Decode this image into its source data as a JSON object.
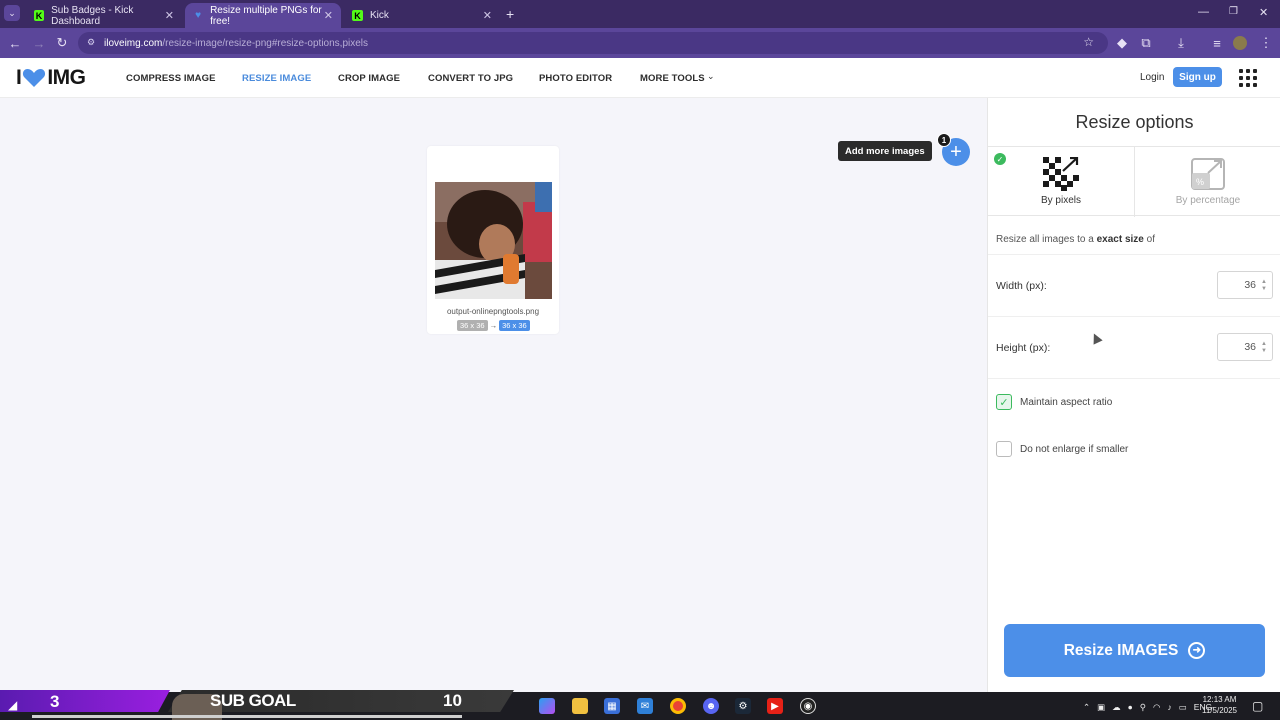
{
  "browser": {
    "tabs": [
      {
        "title": "Sub Badges - Kick Dashboard",
        "favicon": "kick-icon",
        "active": false
      },
      {
        "title": "Resize multiple PNGs for free!",
        "favicon": "iloveimg-heart-icon",
        "active": true
      },
      {
        "title": "Kick",
        "favicon": "kick-icon",
        "active": false
      }
    ],
    "new_tab": "+",
    "url_host": "iloveimg.com",
    "url_path": "/resize-image/resize-png#resize-options,pixels"
  },
  "site": {
    "logo_left": "I",
    "logo_right": "IMG",
    "nav": [
      {
        "label": "COMPRESS IMAGE",
        "active": false
      },
      {
        "label": "RESIZE IMAGE",
        "active": true
      },
      {
        "label": "CROP IMAGE",
        "active": false
      },
      {
        "label": "CONVERT TO JPG",
        "active": false
      },
      {
        "label": "PHOTO EDITOR",
        "active": false
      },
      {
        "label": "MORE TOOLS",
        "active": false
      }
    ],
    "login": "Login",
    "signup": "Sign up"
  },
  "workspace": {
    "file_name": "output-onlinepngtools.png",
    "original_size": "36 x 36",
    "arrow": "→",
    "new_size": "36 x 36",
    "add_more_label": "Add more images",
    "image_count": "1"
  },
  "sidebar": {
    "title": "Resize options",
    "mode_pixels": "By pixels",
    "mode_percentage": "By percentage",
    "desc_prefix": "Resize all images to a ",
    "desc_bold": "exact size",
    "desc_suffix": " of",
    "width_label": "Width (px):",
    "width_value": "36",
    "height_label": "Height (px):",
    "height_value": "36",
    "maintain_aspect": "Maintain aspect ratio",
    "maintain_aspect_checked": true,
    "no_enlarge": "Do not enlarge if smaller",
    "no_enlarge_checked": false,
    "resize_button": "Resize IMAGES"
  },
  "overlay": {
    "sub_count": "3",
    "goal_label": "SUB GOAL",
    "goal_target": "10"
  },
  "taskbar": {
    "language": "ENG",
    "time": "12:13 AM",
    "date": "11/5/2025"
  },
  "colors": {
    "accent": "#4c8fe8",
    "browser_frame": "#3b2a63",
    "check_green": "#3cba5e"
  }
}
